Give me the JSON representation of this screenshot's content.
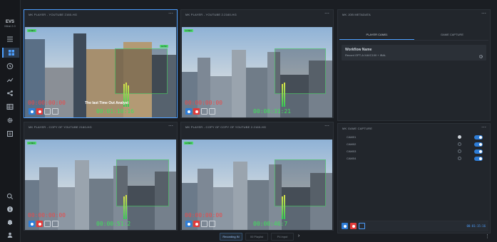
{
  "app": {
    "logo": "EVS",
    "logo_sub": "Mirai 2.0"
  },
  "sidebar": {
    "icons": [
      "menu-icon",
      "grid-icon",
      "clock-icon",
      "chart-icon",
      "share-icon",
      "table-icon",
      "gear-icon",
      "list-icon",
      "search-icon",
      "info-icon",
      "bell-icon",
      "user-icon"
    ]
  },
  "players": [
    {
      "title": "MK PLAYER - YOUTUBE 2160-HG",
      "tc_red": "00:00:00:00",
      "tc_green": "00:01:10:16",
      "overlay": "The last Time Out Analyst",
      "badge": "12:50"
    },
    {
      "title": "MK PLAYER - YOUTUBE 2.2160-HG",
      "tc_red": "00:00:00:00",
      "tc_green": "00:00:31:21"
    },
    {
      "title": "MK PLAYER - COPY OF YOUTUBE 2160-HG",
      "tc_red": "00:00:00:00",
      "tc_green": "00:00:51:2"
    },
    {
      "title": "MK PLAYER - COPY OF COPY OF YOUTUBE 2.2160-HG",
      "tc_red": "00:00:00:00",
      "tc_green": "00:00:46:7"
    }
  ],
  "metadata_panel": {
    "title": "MK JOB METADATA",
    "tabs": [
      "PLAYER CAM01",
      "GAME CAPTURE"
    ],
    "workflow_name_label": "Workflow Name",
    "workflow_value": "Record OPT-A XAVC100 + IBAL"
  },
  "capture_panel": {
    "title": "MK GAME CAPTURE",
    "cameras": [
      {
        "label": "CAM01",
        "selected": true
      },
      {
        "label": "CAM02",
        "selected": false
      },
      {
        "label": "CAM03",
        "selected": false
      },
      {
        "label": "CAM04",
        "selected": false
      }
    ],
    "readout": "00:01:15:16"
  },
  "pager": {
    "items": [
      "Recording IN",
      "00 Playlist",
      "P4 input"
    ],
    "next": "›"
  },
  "colors": {
    "accent": "#4d9fff",
    "record": "#e23b3b",
    "timecode_green": "#3fe35a"
  }
}
